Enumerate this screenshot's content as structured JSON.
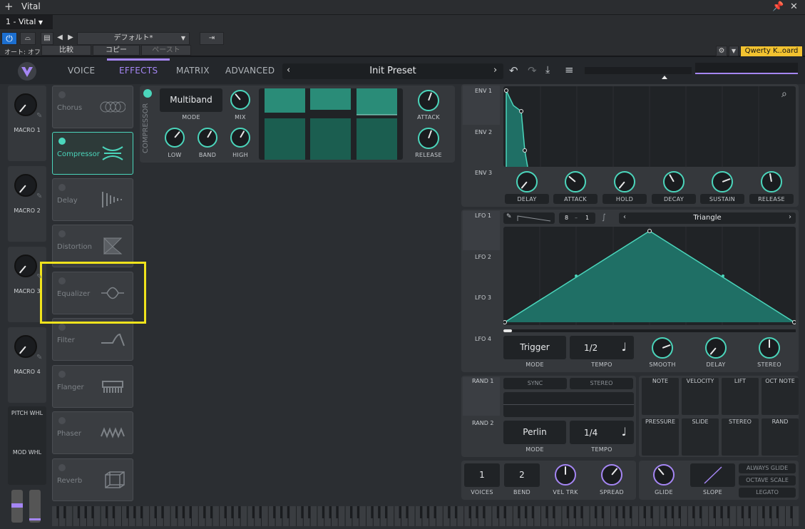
{
  "host": {
    "title": "Vital",
    "tab": "1 - Vital",
    "preset_menu": "デフォルト*",
    "auto_off": "オート: オフ",
    "compare": "比較",
    "copy": "コピー",
    "paste": "ペースト",
    "keyboard": "Qwerty K..oard"
  },
  "nav": {
    "voice": "VOICE",
    "effects": "EFFECTS",
    "matrix": "MATRIX",
    "advanced": "ADVANCED",
    "preset": "Init Preset"
  },
  "macros": [
    "MACRO 1",
    "MACRO 2",
    "MACRO 3",
    "MACRO 4"
  ],
  "wheels": {
    "pitch": "PITCH WHL",
    "mod": "MOD WHL"
  },
  "effects": [
    {
      "name": "Chorus",
      "on": false
    },
    {
      "name": "Compressor",
      "on": true
    },
    {
      "name": "Delay",
      "on": false
    },
    {
      "name": "Distortion",
      "on": false
    },
    {
      "name": "Equalizer",
      "on": false
    },
    {
      "name": "Filter",
      "on": false
    },
    {
      "name": "Flanger",
      "on": false
    },
    {
      "name": "Phaser",
      "on": false
    },
    {
      "name": "Reverb",
      "on": false
    }
  ],
  "compressor": {
    "side_label": "COMPRESSOR",
    "mode_value": "Multiband",
    "mode": "MODE",
    "mix": "MIX",
    "low": "LOW",
    "band": "BAND",
    "high": "HIGH",
    "attack": "ATTACK",
    "release": "RELEASE"
  },
  "env": {
    "tabs": [
      "ENV 1",
      "ENV 2",
      "ENV 3"
    ],
    "knobs": [
      "DELAY",
      "ATTACK",
      "HOLD",
      "DECAY",
      "SUSTAIN",
      "RELEASE"
    ]
  },
  "lfo": {
    "tabs": [
      "LFO 1",
      "LFO 2",
      "LFO 3",
      "LFO 4"
    ],
    "grid_x": "8",
    "grid_sep": "–",
    "grid_y": "1",
    "shape": "Triangle",
    "mode_value": "Trigger",
    "mode": "MODE",
    "tempo_value": "1/2",
    "tempo": "TEMPO",
    "smooth": "SMOOTH",
    "delay": "DELAY",
    "stereo": "STEREO"
  },
  "rand": {
    "tabs": [
      "RAND 1",
      "RAND 2"
    ],
    "sync": "SYNC",
    "stereo": "STEREO",
    "mode_value": "Perlin",
    "mode": "MODE",
    "tempo_value": "1/4",
    "tempo": "TEMPO"
  },
  "mod_sources": [
    "NOTE",
    "VELOCITY",
    "LIFT",
    "OCT NOTE",
    "PRESSURE",
    "SLIDE",
    "STEREO",
    "RAND"
  ],
  "voice": {
    "voices_value": "1",
    "voices": "VOICES",
    "bend_value": "2",
    "bend": "BEND",
    "vel_trk": "VEL TRK",
    "spread": "SPREAD",
    "glide": "GLIDE",
    "slope": "SLOPE",
    "always_glide": "ALWAYS GLIDE",
    "octave_scale": "OCTAVE SCALE",
    "legato": "LEGATO"
  },
  "colors": {
    "accent_teal": "#4bd5bb",
    "accent_purple": "#a586f4",
    "highlight": "#f0e31c"
  }
}
